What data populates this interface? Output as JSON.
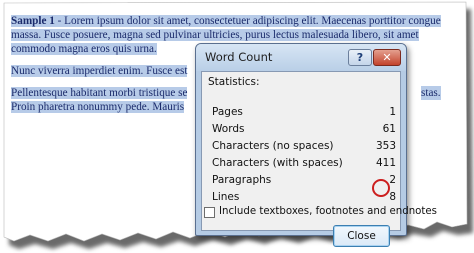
{
  "document": {
    "para1_bold": "Sample 1",
    "para1_text": " - Lorem ipsum dolor sit amet, consectetuer adipiscing elit. Maecenas porttitor congue massa. Fusce posuere, magna sed pulvinar ultricies, purus lectus malesuada libero, sit amet commodo magna eros quis urna.",
    "para2_text": "Nunc viverra imperdiet enim. Fusce est",
    "para3_text": "Pellentesque habitant morbi tristique se",
    "para3_tail": "stas.",
    "para4_text": "Proin pharetra nonummy pede. Mauris"
  },
  "dialog": {
    "title": "Word Count",
    "help_label": "?",
    "close_label": "✕",
    "statistics_label": "Statistics:",
    "stats": [
      {
        "label": "Pages",
        "value": "1"
      },
      {
        "label": "Words",
        "value": "61"
      },
      {
        "label": "Characters (no spaces)",
        "value": "353"
      },
      {
        "label": "Characters (with spaces)",
        "value": "411"
      },
      {
        "label": "Paragraphs",
        "value": "2"
      },
      {
        "label": "Lines",
        "value": "8"
      }
    ],
    "checkbox_label": "Include textboxes, footnotes and endnotes",
    "close_button": "Close"
  },
  "colors": {
    "highlight": "#b7cbe8",
    "annotation_circle": "#cc1f1f"
  }
}
